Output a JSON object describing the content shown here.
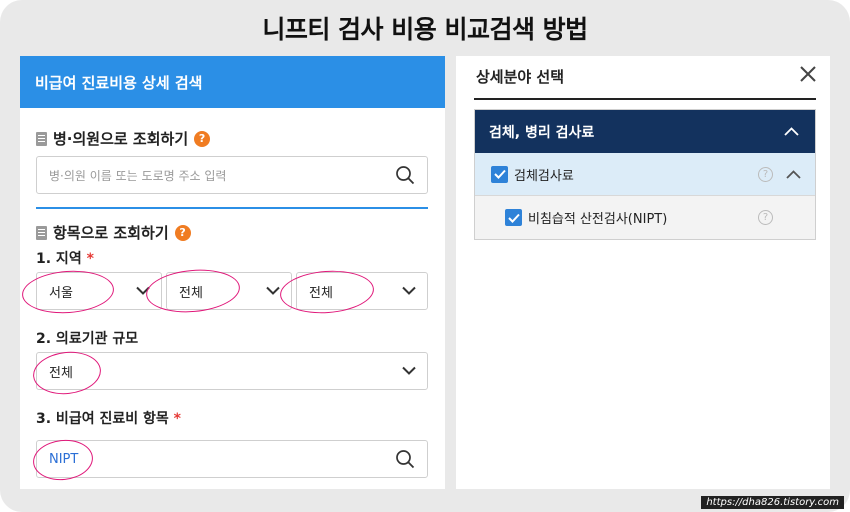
{
  "main_title": "니프티 검사 비용 비교검색 방법",
  "left": {
    "header_title": "비급여 진료비용 상세 검색",
    "hospital_section": {
      "title": "병·의원으로 조회하기",
      "help": "?",
      "search_placeholder": "병·의원 이름 또는 도로명 주소 입력"
    },
    "item_section": {
      "title": "항목으로 조회하기",
      "help": "?"
    },
    "region": {
      "label": "1. 지역",
      "required": "*",
      "selects": [
        "서울",
        "전체",
        "전체"
      ]
    },
    "size": {
      "label": "2. 의료기관 규모",
      "value": "전체"
    },
    "item": {
      "label": "3. 비급여 진료비 항목",
      "required": "*",
      "value": "NIPT"
    }
  },
  "right": {
    "title": "상세분야 선택",
    "close": "✕",
    "category": "검체, 병리 검사료",
    "subcategory": "검체검사료",
    "item": "비침습적 산전검사(NIPT)",
    "help": "?"
  },
  "watermark": "https://dha826.tistory.com",
  "colors": {
    "header_blue": "#2b8fe6",
    "navy": "#13325e",
    "highlight_circle": "#e0187a",
    "help_orange": "#f07c22",
    "checkbox_blue": "#2e82d8"
  }
}
